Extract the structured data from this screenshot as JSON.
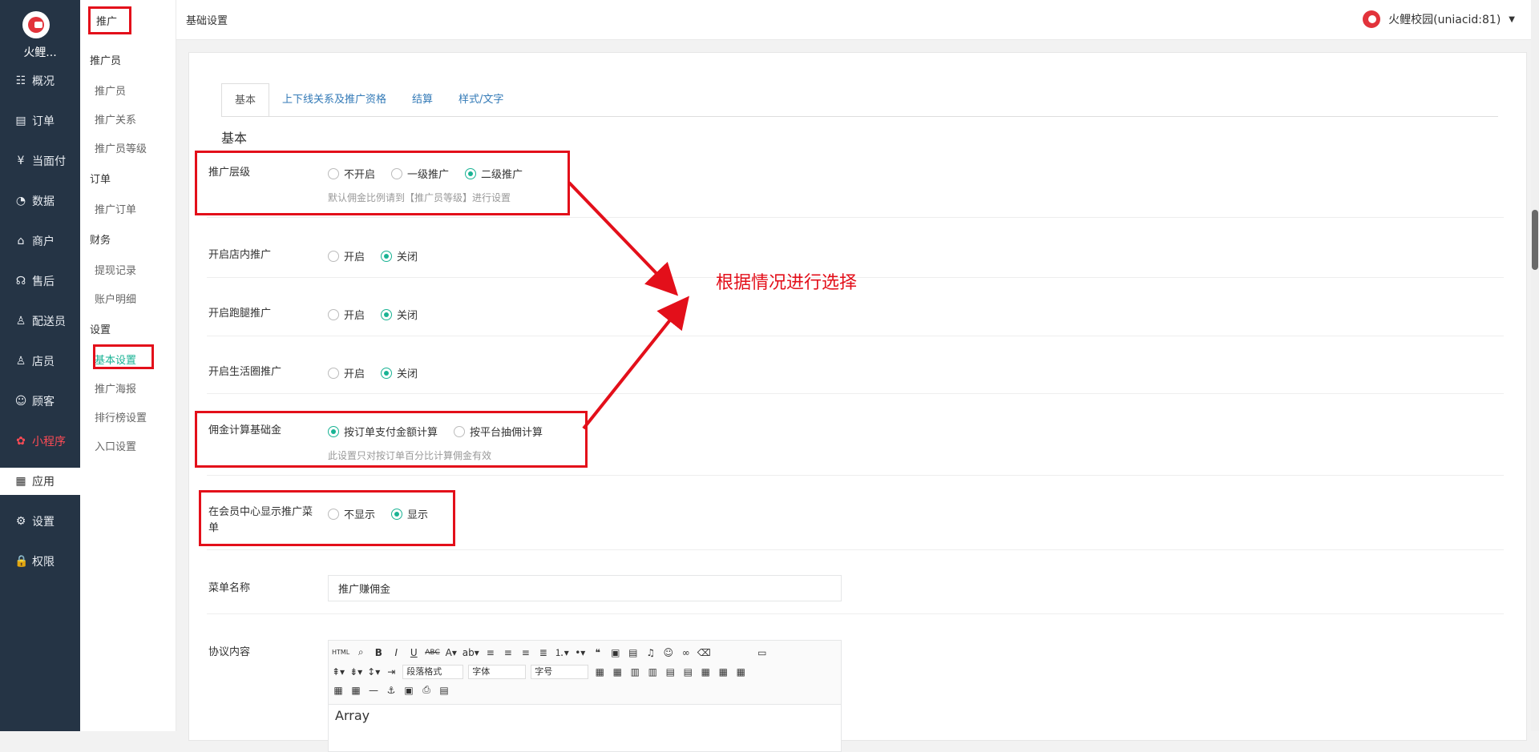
{
  "rail": {
    "brand": "火鲤...",
    "items": [
      {
        "label": "概况",
        "icon": "dashboard-icon",
        "glyph": "☷"
      },
      {
        "label": "订单",
        "icon": "order-icon",
        "glyph": "▤"
      },
      {
        "label": "当面付",
        "icon": "yen-icon",
        "glyph": "¥"
      },
      {
        "label": "数据",
        "icon": "chart-icon",
        "glyph": "◔"
      },
      {
        "label": "商户",
        "icon": "store-icon",
        "glyph": "⌂"
      },
      {
        "label": "售后",
        "icon": "service-icon",
        "glyph": "☊"
      },
      {
        "label": "配送员",
        "icon": "courier-icon",
        "glyph": "♙"
      },
      {
        "label": "店员",
        "icon": "staff-icon",
        "glyph": "♙"
      },
      {
        "label": "顾客",
        "icon": "customer-icon",
        "glyph": "☺"
      },
      {
        "label": "小程序",
        "icon": "miniprogram-icon",
        "glyph": "✿"
      },
      {
        "label": "应用",
        "icon": "apps-icon",
        "glyph": "▦"
      },
      {
        "label": "设置",
        "icon": "gear-icon",
        "glyph": "⚙"
      },
      {
        "label": "权限",
        "icon": "lock-icon",
        "glyph": "🔒"
      }
    ]
  },
  "sub": {
    "title": "推广",
    "g1": "推广员",
    "g1_items": [
      "推广员",
      "推广关系",
      "推广员等级"
    ],
    "g2": "订单",
    "g2_items": [
      "推广订单"
    ],
    "g3": "财务",
    "g3_items": [
      "提现记录",
      "账户明细"
    ],
    "g4": "设置",
    "g4_items": [
      "基本设置",
      "推广海报",
      "排行榜设置",
      "入口设置"
    ]
  },
  "topbar": {
    "crumb": "基础设置",
    "user": "火鲤校园(uniacid:81)"
  },
  "tabs": [
    "基本",
    "上下线关系及推广资格",
    "结算",
    "样式/文字"
  ],
  "section": "基本",
  "form": {
    "level": {
      "label": "推广层级",
      "opts": [
        "不开启",
        "一级推广",
        "二级推广"
      ],
      "selected": 2,
      "help": "默认佣金比例请到【推广员等级】进行设置"
    },
    "store": {
      "label": "开启店内推广",
      "opts": [
        "开启",
        "关闭"
      ],
      "selected": 1
    },
    "errand": {
      "label": "开启跑腿推广",
      "opts": [
        "开启",
        "关闭"
      ],
      "selected": 1
    },
    "life": {
      "label": "开启生活圈推广",
      "opts": [
        "开启",
        "关闭"
      ],
      "selected": 1
    },
    "basis": {
      "label": "佣金计算基础金",
      "opts": [
        "按订单支付金额计算",
        "按平台抽佣计算"
      ],
      "selected": 0,
      "help": "此设置只对按订单百分比计算佣金有效"
    },
    "menu_show": {
      "label": "在会员中心显示推广菜单",
      "opts": [
        "不显示",
        "显示"
      ],
      "selected": 1
    },
    "menu_name": {
      "label": "菜单名称",
      "value": "推广赚佣金"
    },
    "agreement": {
      "label": "协议内容",
      "content": "Array",
      "sel_para": "段落格式",
      "sel_font": "字体",
      "sel_size": "字号"
    }
  },
  "annotation": "根据情况进行选择"
}
